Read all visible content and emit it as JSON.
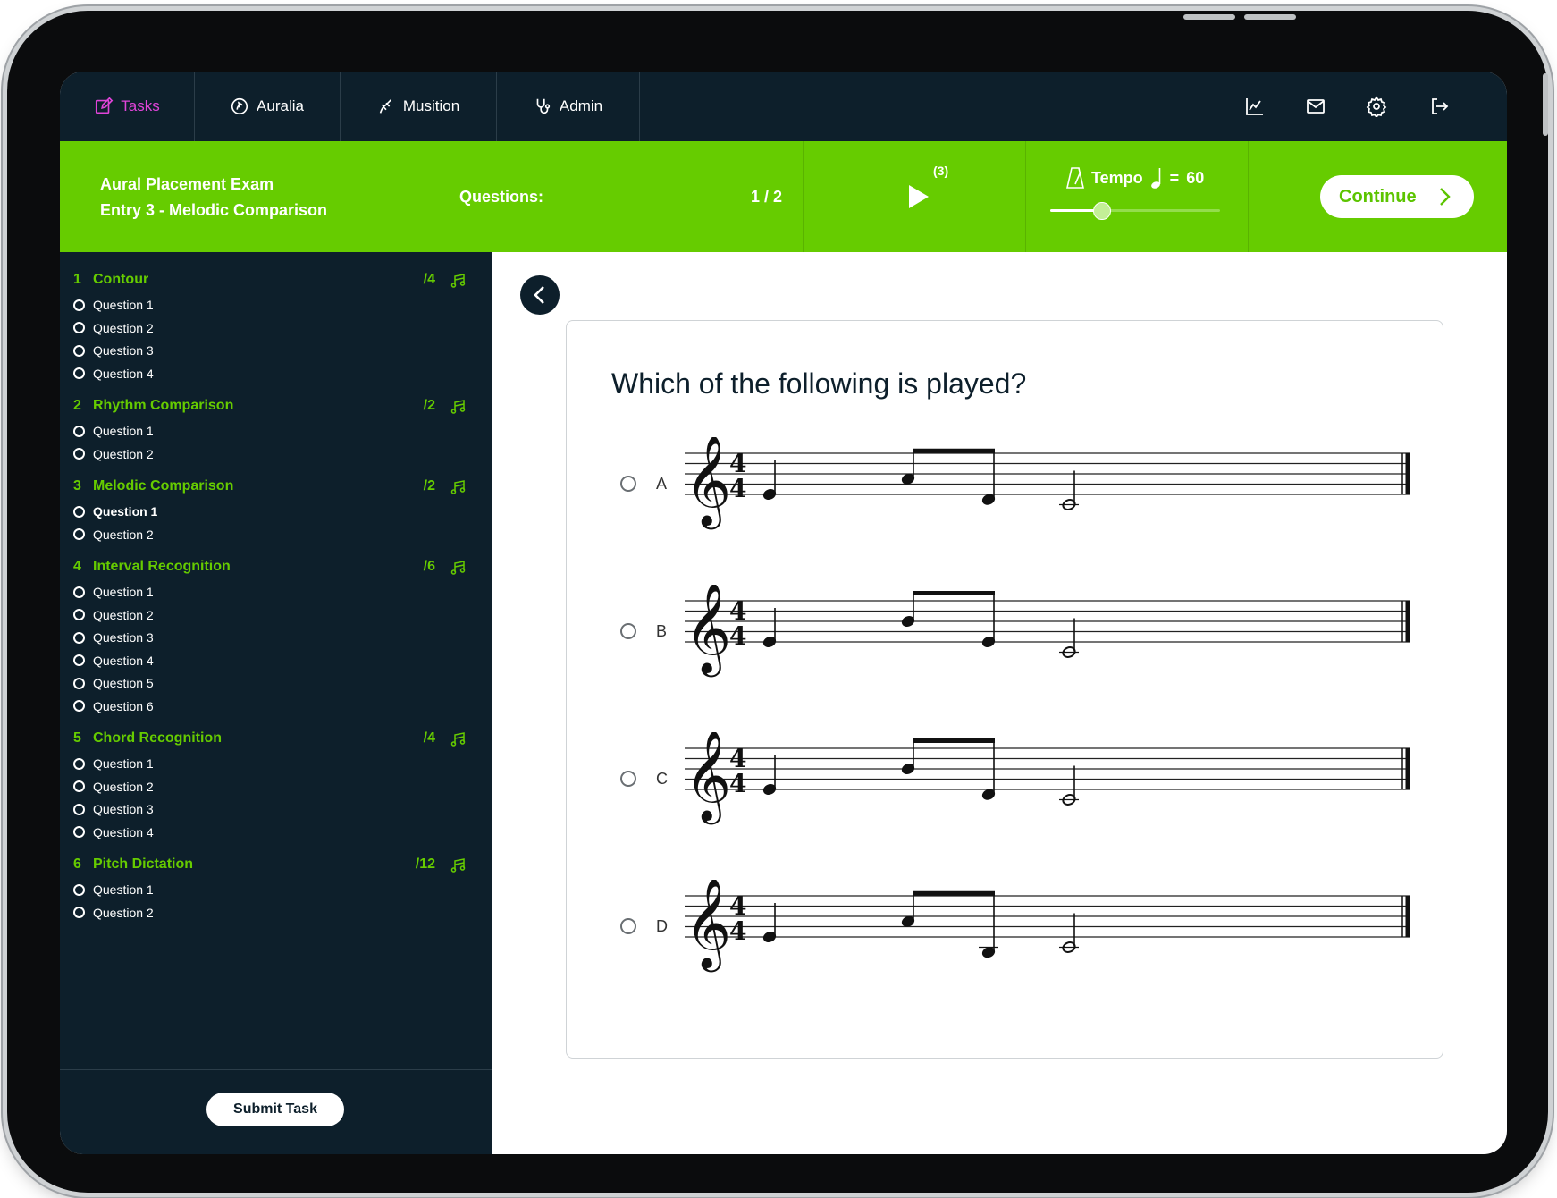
{
  "nav": {
    "tabs": [
      {
        "label": "Tasks",
        "icon": "edit-icon",
        "active": true
      },
      {
        "label": "Auralia",
        "icon": "ear-icon",
        "active": false
      },
      {
        "label": "Musition",
        "icon": "hand-icon",
        "active": false
      },
      {
        "label": "Admin",
        "icon": "stethoscope-icon",
        "active": false
      }
    ],
    "right_icons": [
      "chart-icon",
      "mail-icon",
      "gear-icon",
      "logout-icon"
    ]
  },
  "header": {
    "exam_title": "Aural Placement Exam",
    "exam_subtitle": "Entry 3 - Melodic Comparison",
    "questions_label": "Questions:",
    "questions_count": "1 / 2",
    "play_count": "(3)",
    "tempo_label": "Tempo",
    "tempo_equals": "=",
    "tempo_value": "60",
    "tempo_level": 0.3,
    "continue_label": "Continue"
  },
  "sidebar": {
    "sections": [
      {
        "num": "1",
        "name": "Contour",
        "score": "/4",
        "questions": [
          "Question 1",
          "Question 2",
          "Question 3",
          "Question 4"
        ]
      },
      {
        "num": "2",
        "name": "Rhythm Comparison",
        "score": "/2",
        "questions": [
          "Question 1",
          "Question 2"
        ]
      },
      {
        "num": "3",
        "name": "Melodic Comparison",
        "score": "/2",
        "questions": [
          "Question 1",
          "Question 2"
        ]
      },
      {
        "num": "4",
        "name": "Interval Recognition",
        "score": "/6",
        "questions": [
          "Question 1",
          "Question 2",
          "Question 3",
          "Question 4",
          "Question 5",
          "Question 6"
        ]
      },
      {
        "num": "5",
        "name": "Chord Recognition",
        "score": "/4",
        "questions": [
          "Question 1",
          "Question 2",
          "Question 3",
          "Question 4"
        ]
      },
      {
        "num": "6",
        "name": "Pitch Dictation",
        "score": "/12",
        "questions": [
          "Question 1",
          "Question 2"
        ]
      }
    ],
    "current_section": 2,
    "current_question": 0,
    "submit_label": "Submit Task"
  },
  "main": {
    "prompt": "Which of the following is played?",
    "time_signature": "4/4",
    "options": [
      {
        "letter": "A",
        "notes": [
          "E4",
          "A4",
          "D4",
          "C4"
        ]
      },
      {
        "letter": "B",
        "notes": [
          "E4",
          "B4",
          "E4",
          "C4"
        ]
      },
      {
        "letter": "C",
        "notes": [
          "E4",
          "B4",
          "D4",
          "C4"
        ]
      },
      {
        "letter": "D",
        "notes": [
          "E4",
          "A4",
          "B3",
          "C4"
        ]
      }
    ]
  },
  "colors": {
    "accent_green": "#66cc00",
    "navy": "#0d1f2b",
    "active_tab": "#e044d9"
  }
}
